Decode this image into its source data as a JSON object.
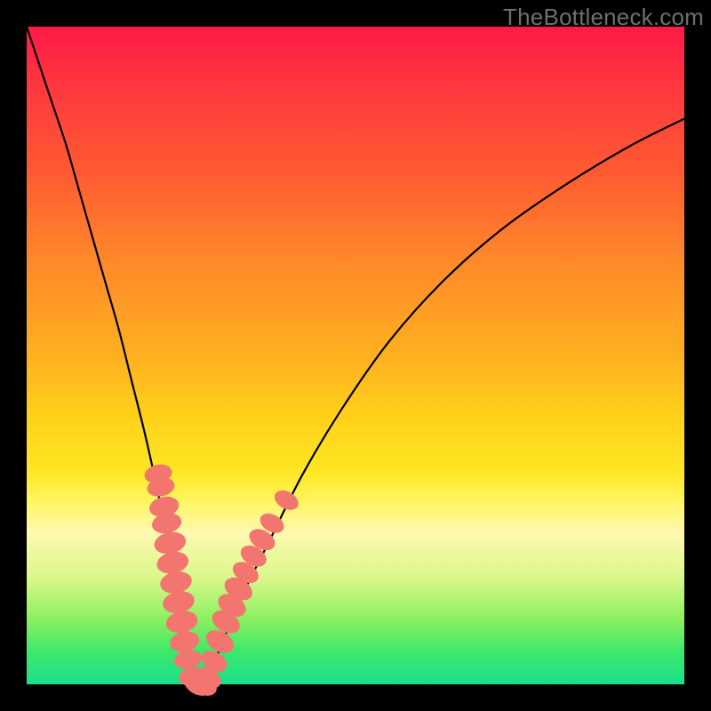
{
  "watermark_text": "TheBottleneck.com",
  "colors": {
    "frame": "#000000",
    "watermark": "#6f6f6f",
    "curve": "#000000",
    "marker": "#f2766f",
    "gradient_top": "#ff1a47",
    "gradient_bottom": "#18e08c"
  },
  "chart_data": {
    "type": "line",
    "title": "",
    "xlabel": "",
    "ylabel": "",
    "xlim": [
      0,
      100
    ],
    "ylim": [
      0,
      100
    ],
    "grid": false,
    "legend": false,
    "series": [
      {
        "name": "bottleneck-curve",
        "x": [
          0,
          2,
          4,
          6,
          8,
          10,
          12,
          14,
          16,
          18,
          20,
          22,
          23.5,
          25,
          26.5,
          28,
          30,
          33,
          37,
          42,
          48,
          55,
          63,
          72,
          82,
          92,
          100
        ],
        "y": [
          100,
          94,
          88,
          82,
          75,
          68,
          61,
          54,
          46,
          38,
          29,
          19,
          11,
          4,
          0,
          2,
          7,
          14,
          22,
          32,
          42,
          52,
          61,
          69,
          76,
          82,
          86
        ]
      }
    ],
    "markers": [
      {
        "x": 20.0,
        "y": 32.0,
        "r": 1.3
      },
      {
        "x": 20.4,
        "y": 30.0,
        "r": 1.3
      },
      {
        "x": 20.9,
        "y": 27.0,
        "r": 1.4
      },
      {
        "x": 21.3,
        "y": 24.5,
        "r": 1.4
      },
      {
        "x": 21.8,
        "y": 21.5,
        "r": 1.5
      },
      {
        "x": 22.2,
        "y": 18.5,
        "r": 1.5
      },
      {
        "x": 22.7,
        "y": 15.5,
        "r": 1.5
      },
      {
        "x": 23.1,
        "y": 12.5,
        "r": 1.5
      },
      {
        "x": 23.6,
        "y": 9.5,
        "r": 1.5
      },
      {
        "x": 24.0,
        "y": 6.5,
        "r": 1.4
      },
      {
        "x": 24.5,
        "y": 3.8,
        "r": 1.3
      },
      {
        "x": 25.2,
        "y": 1.2,
        "r": 1.3
      },
      {
        "x": 26.0,
        "y": 0.0,
        "r": 1.4
      },
      {
        "x": 26.8,
        "y": 0.0,
        "r": 1.4
      },
      {
        "x": 27.6,
        "y": 1.0,
        "r": 1.3
      },
      {
        "x": 28.5,
        "y": 3.5,
        "r": 1.3
      },
      {
        "x": 29.4,
        "y": 6.5,
        "r": 1.4
      },
      {
        "x": 30.3,
        "y": 9.5,
        "r": 1.4
      },
      {
        "x": 31.2,
        "y": 12.0,
        "r": 1.4
      },
      {
        "x": 32.2,
        "y": 14.5,
        "r": 1.4
      },
      {
        "x": 33.3,
        "y": 17.0,
        "r": 1.3
      },
      {
        "x": 34.5,
        "y": 19.5,
        "r": 1.3
      },
      {
        "x": 35.8,
        "y": 22.0,
        "r": 1.3
      },
      {
        "x": 37.3,
        "y": 24.5,
        "r": 1.2
      },
      {
        "x": 39.5,
        "y": 28.0,
        "r": 1.2
      }
    ]
  }
}
